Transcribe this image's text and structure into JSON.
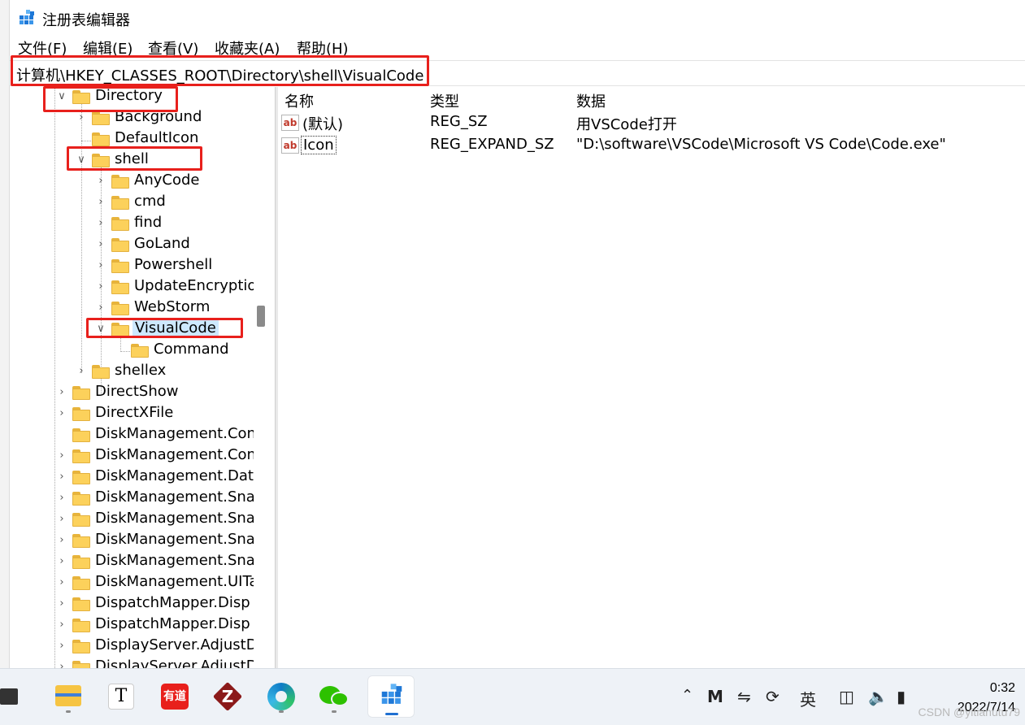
{
  "window": {
    "title": "注册表编辑器"
  },
  "menu": [
    "文件(F)",
    "编辑(E)",
    "查看(V)",
    "收藏夹(A)",
    "帮助(H)"
  ],
  "address": "计算机\\HKEY_CLASSES_ROOT\\Directory\\shell\\VisualCode",
  "tree": {
    "directory": "Directory",
    "background": "Background",
    "defaulticon": "DefaultIcon",
    "shell": "shell",
    "anycode": "AnyCode",
    "cmd": "cmd",
    "find": "find",
    "goland": "GoLand",
    "powershell": "Powershell",
    "updateencryption": "UpdateEncryptio",
    "webstorm": "WebStorm",
    "visualcode": "VisualCode",
    "command": "Command",
    "shellex": "shellex",
    "directshow": "DirectShow",
    "directxfile": "DirectXFile",
    "dm1": "DiskManagement.Con",
    "dm2": "DiskManagement.Con",
    "dm3": "DiskManagement.Data",
    "dm4": "DiskManagement.Snap",
    "dm5": "DiskManagement.Snap",
    "dm6": "DiskManagement.Snap",
    "dm7": "DiskManagement.Snap",
    "dm8": "DiskManagement.UITa",
    "dispatch1": "DispatchMapper.Disp",
    "dispatch2": "DispatchMapper.Disp",
    "display1": "DisplayServer.AdjustD",
    "display2": "DisplayServer.AdjustD"
  },
  "list": {
    "columns": [
      "名称",
      "类型",
      "数据"
    ],
    "rows": [
      {
        "name": "(默认)",
        "type": "REG_SZ",
        "data": "用VSCode打开"
      },
      {
        "name": "Icon",
        "type": "REG_EXPAND_SZ",
        "data": "\"D:\\software\\VSCode\\Microsoft VS Code\\Code.exe\""
      }
    ],
    "value_icon_text": "ab"
  },
  "taskbar": {
    "apps": [
      "file-explorer-icon",
      "typora-icon",
      "youdao-icon",
      "filezilla-icon",
      "edge-icon",
      "wechat-icon",
      "regedit-icon"
    ],
    "youdao_label": "有道",
    "typora_label": "T",
    "z_label": "Z"
  },
  "tray": {
    "ime": "英",
    "time": "0:32",
    "date": "2022/7/14"
  },
  "watermark": "CSDN @yitianutu79",
  "colors": {
    "highlight": "#e8201c",
    "selection": "#cde8ff",
    "folder": "#fcd15b"
  }
}
